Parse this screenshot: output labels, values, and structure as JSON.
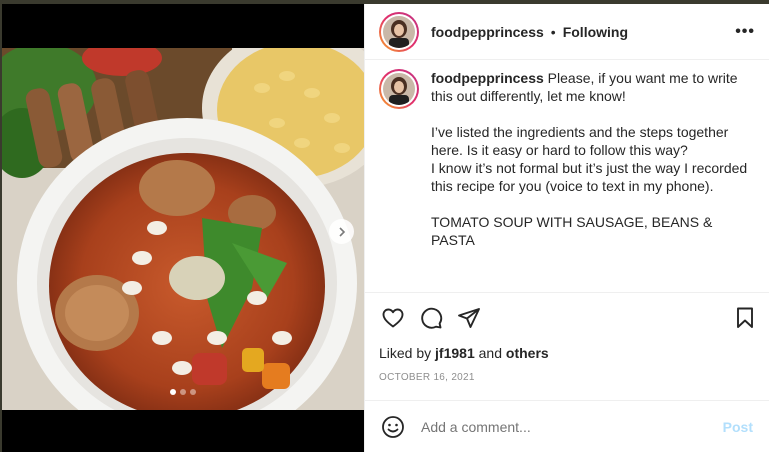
{
  "post": {
    "username": "foodpepprincess",
    "separator": "•",
    "follow_status": "Following",
    "more_label": "•••",
    "caption": {
      "username": "foodpepprincess",
      "text": " Please, if you want me to write this out differently, let me know!\n\nI’ve listed the ingredients and the steps together here. Is it easy or hard to follow this way?\nI know it’s not formal but it’s just the way I recorded this recipe for you (voice to text in my phone).\n\nTOMATO SOUP WITH SAUSAGE, BEANS & PASTA"
    },
    "liked_by_prefix": "Liked by ",
    "liked_by_user": "jf1981",
    "liked_by_mid": " and ",
    "liked_by_others": "others",
    "date": "OCTOBER 16, 2021"
  },
  "comment": {
    "placeholder": "Add a comment...",
    "post_label": "Post"
  },
  "carousel": {
    "slide_count": 3,
    "active_index": 0
  },
  "icons": {
    "like": "heart-icon",
    "comment": "comment-icon",
    "share": "paper-plane-icon",
    "save": "bookmark-icon",
    "emoji": "emoji-icon",
    "next": "chevron-right-icon"
  },
  "colors": {
    "post_button_disabled": "#b2dffc",
    "meta_gray": "#8e8e8e",
    "text": "#262626"
  }
}
